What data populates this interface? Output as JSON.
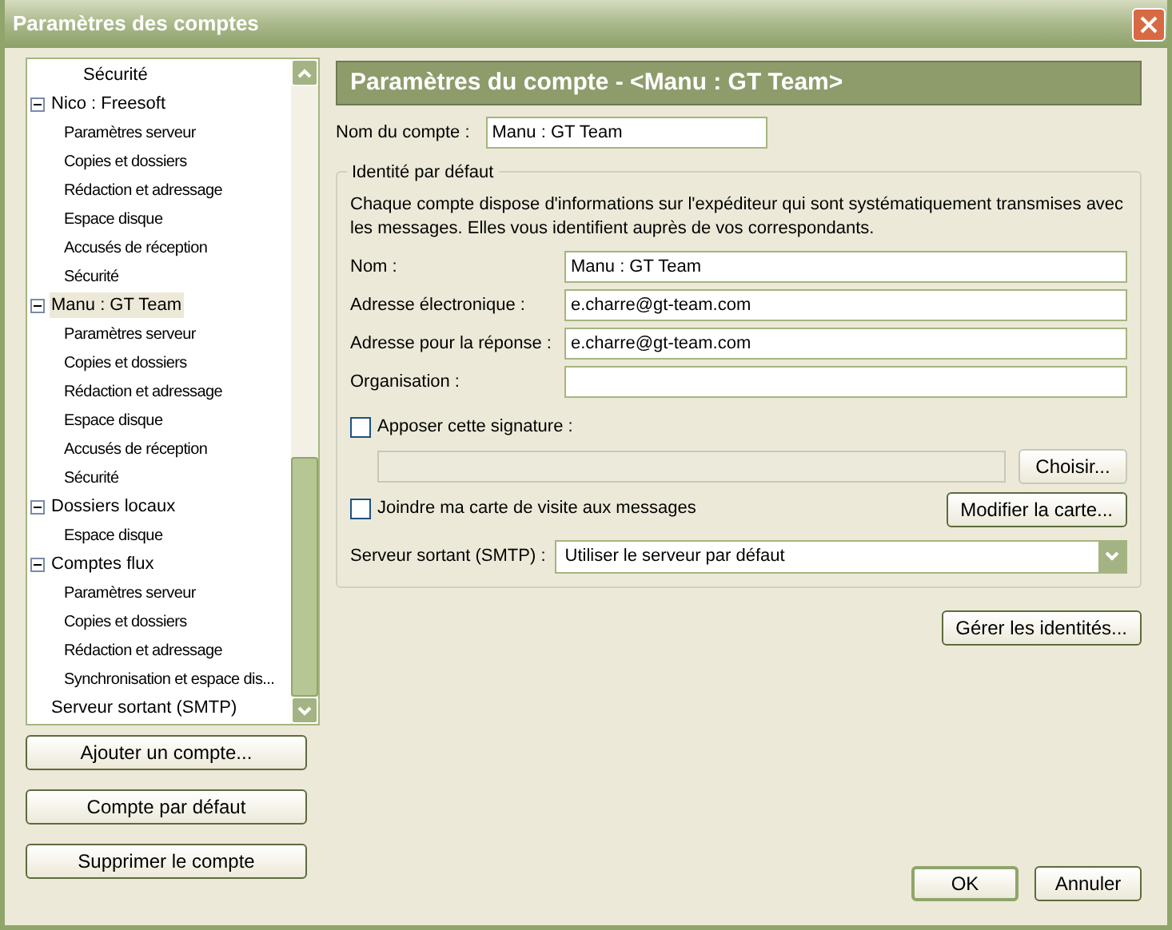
{
  "window": {
    "title": "Paramètres des comptes"
  },
  "tree": {
    "items": [
      {
        "label": "Sécurité",
        "kind": "continued"
      },
      {
        "label": "Nico : Freesoft",
        "expanded": true,
        "selected": false,
        "children": [
          {
            "label": "Paramètres serveur",
            "selected": false
          },
          {
            "label": "Copies et dossiers",
            "selected": false
          },
          {
            "label": "Rédaction et adressage",
            "selected": false
          },
          {
            "label": "Espace disque",
            "selected": false
          },
          {
            "label": "Accusés de réception",
            "selected": false
          },
          {
            "label": "Sécurité",
            "selected": false
          }
        ]
      },
      {
        "label": "Manu : GT Team",
        "expanded": true,
        "selected": true,
        "children": [
          {
            "label": "Paramètres serveur",
            "selected": false
          },
          {
            "label": "Copies et dossiers",
            "selected": false
          },
          {
            "label": "Rédaction et adressage",
            "selected": false
          },
          {
            "label": "Espace disque",
            "selected": false
          },
          {
            "label": "Accusés de réception",
            "selected": false
          },
          {
            "label": "Sécurité",
            "selected": false
          }
        ]
      },
      {
        "label": "Dossiers locaux",
        "expanded": true,
        "selected": false,
        "children": [
          {
            "label": "Espace disque",
            "selected": false
          }
        ]
      },
      {
        "label": "Comptes flux",
        "expanded": true,
        "selected": false,
        "children": [
          {
            "label": "Paramètres serveur",
            "selected": false
          },
          {
            "label": "Copies et dossiers",
            "selected": false
          },
          {
            "label": "Rédaction et adressage",
            "selected": false
          },
          {
            "label": "Synchronisation et espace dis...",
            "selected": false
          }
        ]
      },
      {
        "label": "Serveur sortant (SMTP)",
        "selected": false
      }
    ]
  },
  "left_buttons": [
    "Ajouter un compte...",
    "Compte par défaut",
    "Supprimer le compte"
  ],
  "header": {
    "title": "Paramètres du compte - <Manu : GT Team>"
  },
  "account_name": {
    "label": "Nom du compte :",
    "value": "Manu : GT Team"
  },
  "identity": {
    "legend": "Identité par défaut",
    "description": "Chaque compte dispose d'informations sur l'expéditeur qui sont systématiquement transmises avec les messages. Elles vous identifient auprès de vos correspondants.",
    "fields": [
      {
        "label": "Nom :",
        "value": "Manu : GT Team"
      },
      {
        "label": "Adresse électronique :",
        "value": "e.charre@gt-team.com"
      },
      {
        "label": "Adresse pour la réponse :",
        "value": "e.charre@gt-team.com"
      },
      {
        "label": "Organisation :"
      }
    ],
    "signature": {
      "label": "Apposer cette signature :",
      "checked": false
    },
    "signature_field": {
      "disabled": true
    },
    "choose_button": {
      "label": "Choisir...",
      "disabled": true
    },
    "vcard": {
      "label": "Joindre ma carte de visite aux messages",
      "checked": false
    },
    "modify_button": {
      "label": "Modifier la carte..."
    },
    "smtp": {
      "label": "Serveur sortant (SMTP) :",
      "value": "Utiliser le serveur par défaut"
    }
  },
  "manage_identities": "Gérer les identités...",
  "footer_buttons": [
    "OK",
    "Annuler"
  ]
}
